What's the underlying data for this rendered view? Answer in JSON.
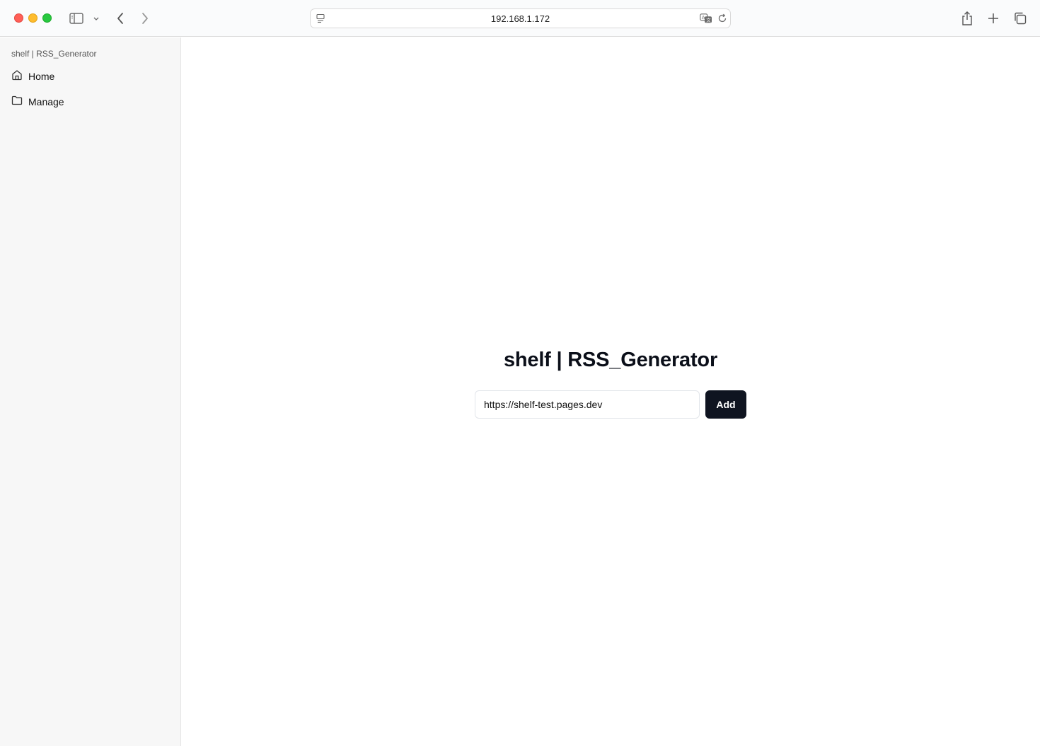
{
  "browser": {
    "url": "192.168.1.172",
    "icons": [
      "sidebar-toggle-icon",
      "chevron-down-icon",
      "back-icon",
      "forward-icon",
      "page-menu-icon",
      "translate-icon",
      "reload-icon",
      "share-icon",
      "new-tab-icon",
      "tabs-overview-icon"
    ]
  },
  "sidebar": {
    "title": "shelf | RSS_Generator",
    "items": [
      {
        "label": "Home",
        "icon": "home-icon"
      },
      {
        "label": "Manage",
        "icon": "folder-icon"
      }
    ]
  },
  "main": {
    "title": "shelf | RSS_Generator",
    "input_value": "https://shelf-test.pages.dev",
    "add_label": "Add"
  }
}
